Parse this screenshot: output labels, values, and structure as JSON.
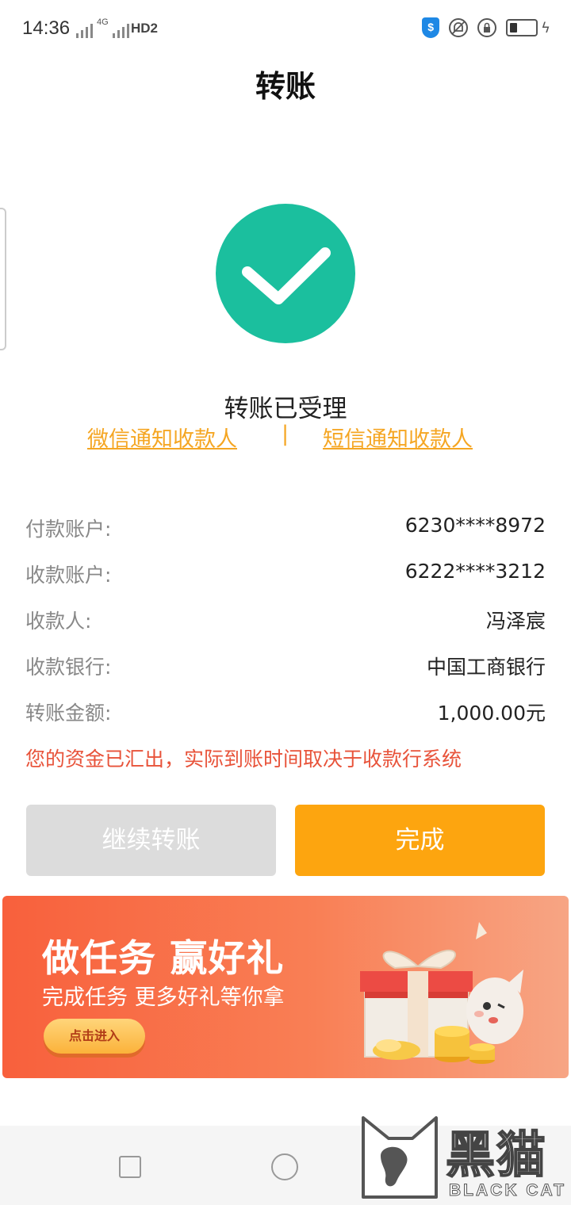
{
  "status_bar": {
    "time": "14:36",
    "network": "4G",
    "hd_label": "HD2",
    "icons": [
      "signal-icon",
      "hd-icon",
      "shield-icon",
      "bell-off-icon",
      "lock-icon",
      "battery-icon",
      "charging-icon"
    ]
  },
  "header": {
    "title": "转账"
  },
  "success": {
    "message": "转账已受理",
    "accent_color": "#1bbf9e",
    "icon": "check-icon"
  },
  "notify": {
    "wechat_label": "微信通知收款人",
    "separator": "|",
    "sms_label": "短信通知收款人",
    "link_color": "#f5a623"
  },
  "details": [
    {
      "label": "付款账户:",
      "value": "6230****8972"
    },
    {
      "label": "收款账户:",
      "value": "6222****3212"
    },
    {
      "label": "收款人:",
      "value": "冯泽宸"
    },
    {
      "label": "收款银行:",
      "value": "中国工商银行"
    },
    {
      "label": "转账金额:",
      "value": "1,000.00元"
    }
  ],
  "notice": "您的资金已汇出，实际到账时间取决于收款行系统",
  "buttons": {
    "continue_label": "继续转账",
    "done_label": "完成",
    "done_color": "#fda50f"
  },
  "banner": {
    "title": "做任务 赢好礼",
    "subtitle": "完成任务 更多好礼等你拿",
    "cta": "点击进入"
  },
  "watermark": {
    "cn": "黑猫",
    "en": "BLACK CAT"
  }
}
